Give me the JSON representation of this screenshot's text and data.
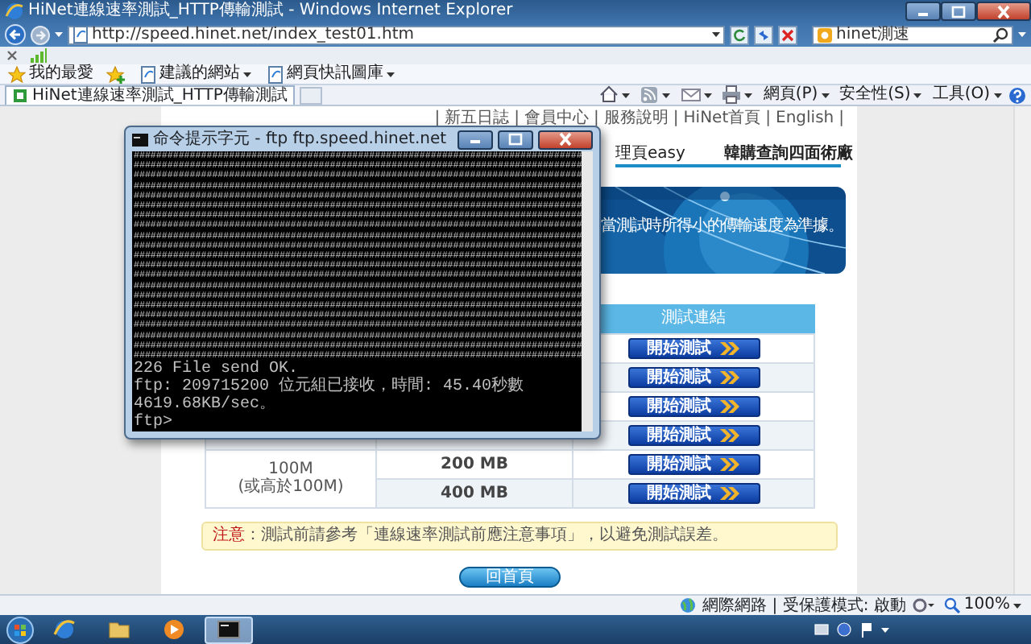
{
  "window": {
    "title": "HiNet連線速率測試_HTTP傳輸測試 - Windows Internet Explorer"
  },
  "address_bar": {
    "url": "http://speed.hinet.net/index_test01.htm"
  },
  "search": {
    "value": "hinet測速"
  },
  "favorites_bar": {
    "title": "我的最愛",
    "items": [
      "建議的網站",
      "網頁快訊圖庫"
    ]
  },
  "tabs": [
    {
      "label": "HiNet連線速率測試_HTTP傳輸測試",
      "selected": true
    }
  ],
  "command_bar": [
    "網頁(P)",
    "安全性(S)",
    "工具(O)"
  ],
  "page": {
    "top_links": [
      "新五日誌",
      "會員中心",
      "服務說明",
      "HiNet首頁",
      "English"
    ],
    "separator": "|",
    "nav": [
      {
        "label": "理頁easy",
        "selected": false
      },
      {
        "label": "韓購查詢四面術廠",
        "selected": true
      }
    ],
    "banner_text": "當測試時所得小的傳輸速度為準據。",
    "table": {
      "header": "測試連結",
      "upper_rows": [
        {
          "button": "開始測試"
        },
        {
          "button": "開始測試"
        },
        {
          "button": "開始測試"
        },
        {
          "button": "開始測試"
        }
      ],
      "groups": [
        {
          "label": "100M\n(或高於100M)",
          "rows": [
            {
              "size": "200 MB",
              "button": "開始測試"
            },
            {
              "size": "400 MB",
              "button": "開始測試"
            }
          ]
        }
      ]
    },
    "notice": {
      "label": "注意",
      "text_before": "：測試前請參考",
      "link": "「連線速率測試前應注意事項」",
      "text_after": "，以避免測試誤差。"
    },
    "home_button": "回首頁"
  },
  "console": {
    "title": "命令提示字元 - ftp  ftp.speed.hinet.net",
    "hash_lines": [
      "################################################################################",
      "################################################################################",
      "################################################################################",
      "################################################################################",
      "################################################################################",
      "################################################################################",
      "################################################################################",
      "################################################################################",
      "################################################################################",
      "################################################################################",
      "################################################################################",
      "################################################################################",
      "################################################################################",
      "################################################################################",
      "################################################################################",
      "################################################################################",
      "################################################################################",
      "################################################################################",
      "################################################################################",
      "################################################################################",
      "################################################################################"
    ],
    "lines": [
      "226 File send OK.",
      "ftp: 209715200 位元組已接收，時間: 45.40秒數 4619.68KB/sec。",
      "ftp>"
    ]
  },
  "status_bar": {
    "zone": "網際網路 | 受保護模式: 啟動",
    "zoom": "100%"
  },
  "taskbar": {
    "items": [
      {
        "kind": "ie",
        "selected": false
      },
      {
        "kind": "folder",
        "selected": false
      },
      {
        "kind": "media",
        "selected": false
      },
      {
        "kind": "console",
        "selected": true
      }
    ]
  }
}
